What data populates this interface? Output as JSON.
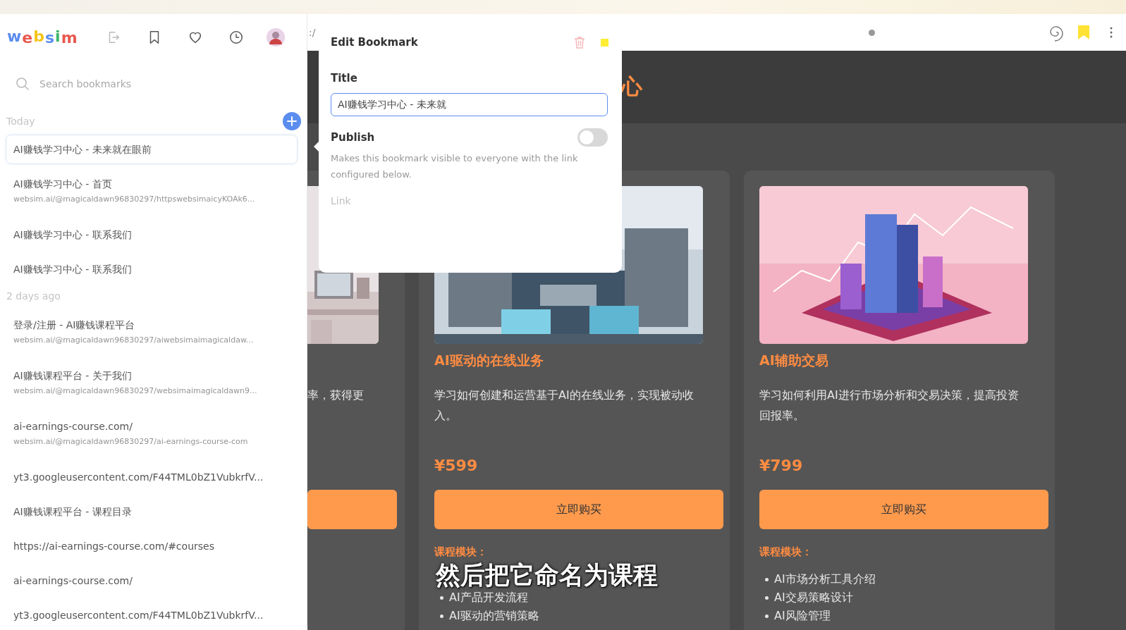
{
  "browser": {
    "url_fragment": ":/"
  },
  "sidebar": {
    "logo": "websim",
    "search": {
      "placeholder": "Search bookmarks"
    },
    "groups": [
      {
        "label": "Today",
        "has_add_button": true,
        "items": [
          {
            "title": "AI赚钱学习中心 - 未来就在眼前",
            "selected": true
          },
          {
            "title": "AI赚钱学习中心 - 首页",
            "url": "websim.ai/@magicaldawn96830297/httpswebsimaicyKOAk6...",
            "selected": false
          },
          {
            "title": "AI赚钱学习中心 - 联系我们",
            "selected": false
          },
          {
            "title": "AI赚钱学习中心 - 联系我们",
            "selected": false
          }
        ]
      },
      {
        "label": "2 days ago",
        "has_add_button": false,
        "items": [
          {
            "title": "登录/注册 - AI赚钱课程平台",
            "url": "websim.ai/@magicaldawn96830297/aiwebsimaimagicaldaw...",
            "selected": false
          },
          {
            "title": "AI赚钱课程平台 - 关于我们",
            "url": "websim.ai/@magicaldawn96830297/websimaimagicaldawn9...",
            "selected": false
          },
          {
            "title": "ai-earnings-course.com/",
            "url": "websim.ai/@magicaldawn96830297/ai-earnings-course-com",
            "selected": false
          },
          {
            "title": "yt3.googleusercontent.com/F44TML0bZ1VubkrfV...",
            "selected": false
          },
          {
            "title": "AI赚钱课程平台 - 课程目录",
            "selected": false
          },
          {
            "title": "https://ai-earnings-course.com/#courses",
            "selected": false
          },
          {
            "title": "ai-earnings-course.com/",
            "selected": false
          },
          {
            "title": "yt3.googleusercontent.com/F44TML0bZ1VubkrfV...",
            "selected": false
          }
        ]
      }
    ]
  },
  "popup": {
    "title": "Edit Bookmark",
    "title_label": "Title",
    "title_value": "AI赚钱学习中心 - 未来就",
    "publish_label": "Publish",
    "publish_on": false,
    "publish_description": "Makes this bookmark visible to everyone with the link configured below.",
    "link_label": "Link"
  },
  "page": {
    "header_fragment": "心",
    "cards": [
      {
        "kind": "partial",
        "description": "率，获得更"
      },
      {
        "kind": "full",
        "title": "AI驱动的在线业务",
        "description": "学习如何创建和运营基于AI的在线业务，实现被动收入。",
        "price": "¥599",
        "button": "立即购买",
        "modules_label": "课程模块：",
        "modules": [
          "AI产品开发流程",
          "AI驱动的营销策略"
        ]
      },
      {
        "kind": "full",
        "title": "AI辅助交易",
        "description": "学习如何利用AI进行市场分析和交易决策，提高投资回报率。",
        "price": "¥799",
        "button": "立即购买",
        "modules_label": "课程模块：",
        "modules": [
          "AI市场分析工具介绍",
          "AI交易策略设计",
          "AI风险管理"
        ]
      }
    ],
    "caption": "然后把它命名为课程"
  }
}
